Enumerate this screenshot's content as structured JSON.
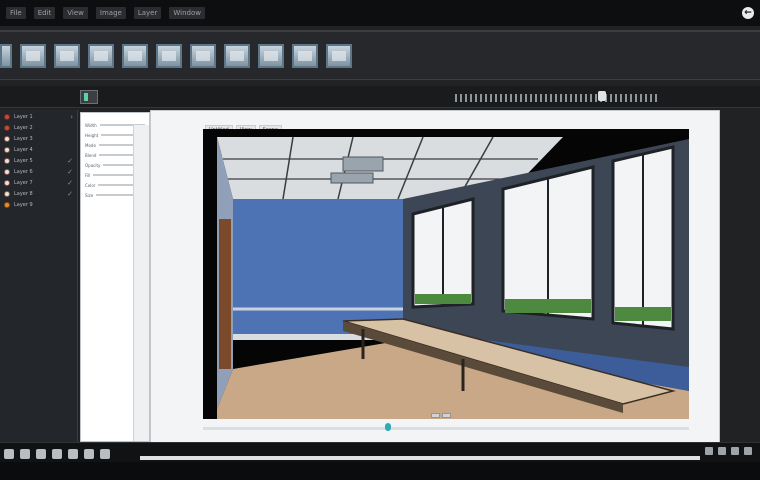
{
  "menubar": {
    "items": [
      "File",
      "Edit",
      "View",
      "Image",
      "Layer",
      "Window"
    ],
    "back_label": "←"
  },
  "toolbar": {
    "thumbnails": 11
  },
  "layers_panel": {
    "items": [
      {
        "label": "Layer 1"
      },
      {
        "label": "Layer 2"
      },
      {
        "label": "Layer 3"
      },
      {
        "label": "Layer 4"
      },
      {
        "label": "Layer 5"
      },
      {
        "label": "Layer 6"
      },
      {
        "label": "Layer 7"
      },
      {
        "label": "Layer 8"
      },
      {
        "label": "Layer 9"
      }
    ]
  },
  "properties_panel": {
    "rows": [
      "Width",
      "Height",
      "Mode",
      "Blend",
      "Opacity",
      "Fill",
      "Color",
      "Size"
    ]
  },
  "document": {
    "tabs": [
      "Untitled",
      "View",
      "Scene"
    ]
  },
  "colors": {
    "accent": "#2fa9b8",
    "wall_blue": "#4e73b4",
    "floor": "#c9a887",
    "ui_dark": "#202224"
  },
  "icons": {
    "back": "back-arrow-icon",
    "thumb": "image-thumbnail-icon"
  }
}
